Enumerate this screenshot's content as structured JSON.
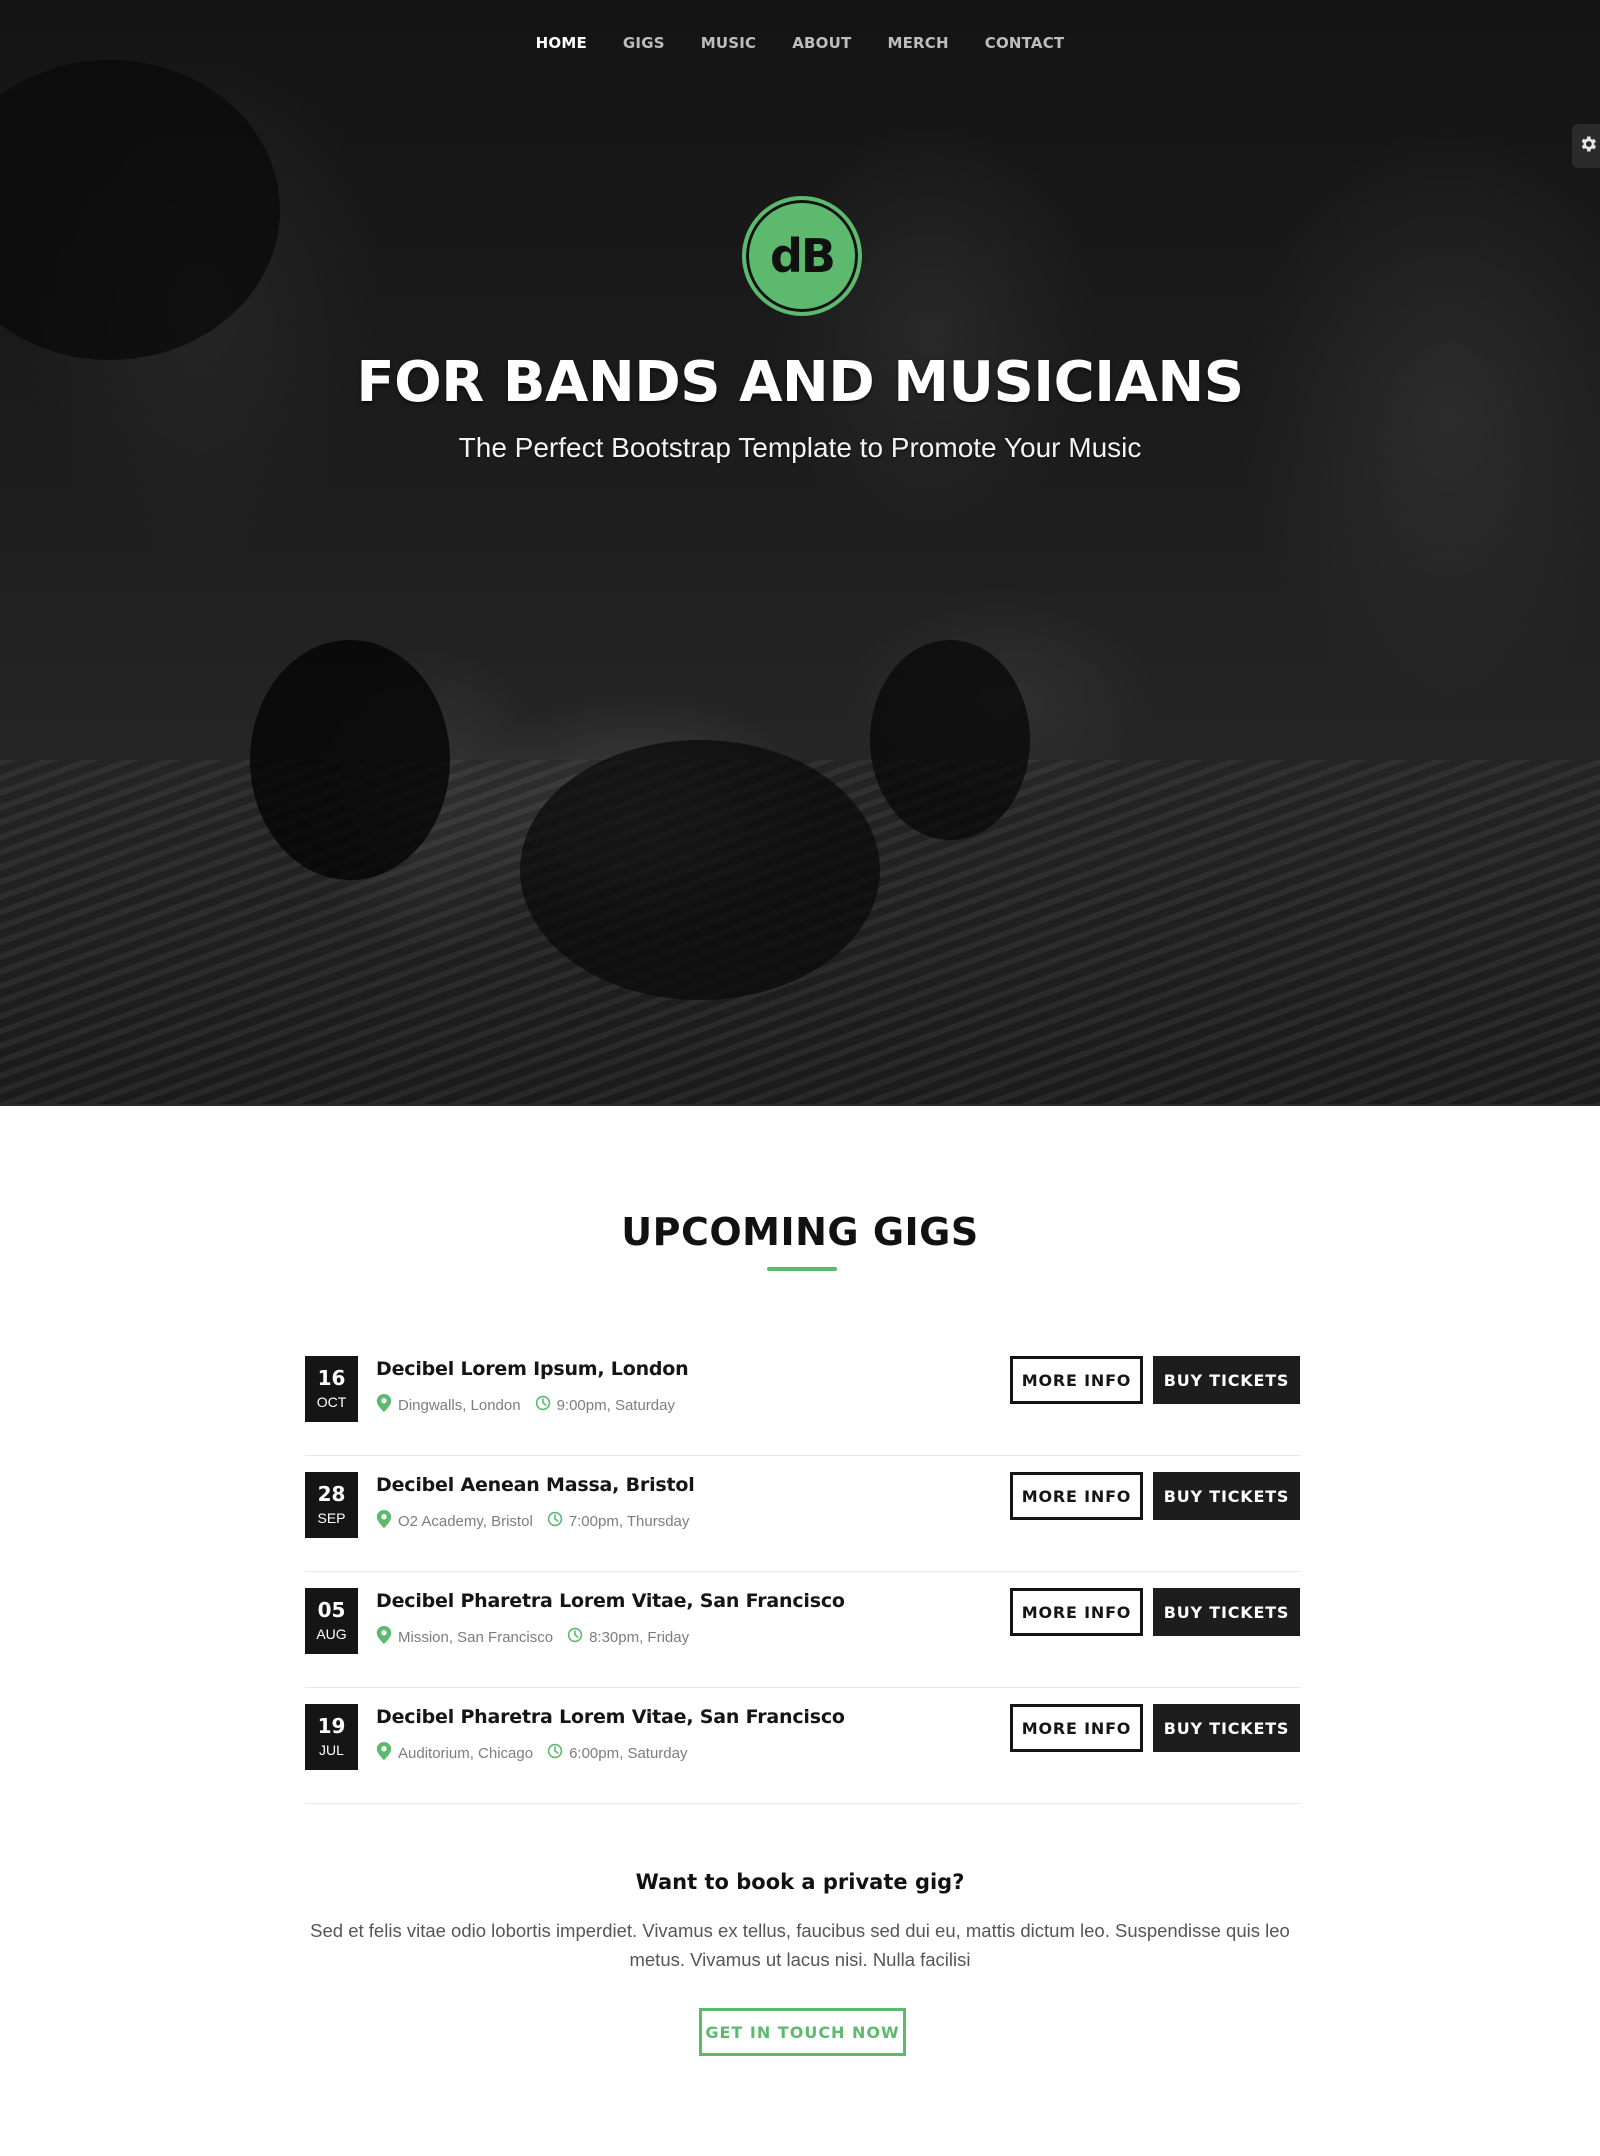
{
  "nav": {
    "items": [
      {
        "label": "HOME",
        "active": true
      },
      {
        "label": "GIGS",
        "active": false
      },
      {
        "label": "MUSIC",
        "active": false
      },
      {
        "label": "ABOUT",
        "active": false
      },
      {
        "label": "MERCH",
        "active": false
      },
      {
        "label": "CONTACT",
        "active": false
      }
    ]
  },
  "settings": {
    "icon": "gear-icon"
  },
  "hero": {
    "logo_text": "dB",
    "title": "FOR BANDS AND MUSICIANS",
    "subtitle": "The Perfect Bootstrap Template to Promote Your Music"
  },
  "gigs": {
    "title": "UPCOMING GIGS",
    "more_info_label": "MORE INFO",
    "buy_tickets_label": "BUY TICKETS",
    "items": [
      {
        "day": "16",
        "month": "OCT",
        "name": "Decibel Lorem Ipsum, London",
        "venue": "Dingwalls, London",
        "time": "9:00pm, Saturday"
      },
      {
        "day": "28",
        "month": "SEP",
        "name": "Decibel Aenean Massa, Bristol",
        "venue": "O2 Academy, Bristol",
        "time": "7:00pm, Thursday"
      },
      {
        "day": "05",
        "month": "AUG",
        "name": "Decibel Pharetra Lorem Vitae, San Francisco",
        "venue": "Mission, San Francisco",
        "time": "8:30pm, Friday"
      },
      {
        "day": "19",
        "month": "JUL",
        "name": "Decibel Pharetra Lorem Vitae, San Francisco",
        "venue": "Auditorium, Chicago",
        "time": "6:00pm, Saturday"
      }
    ]
  },
  "private_gig": {
    "title": "Want to book a private gig?",
    "text": "Sed et felis vitae odio lobortis imperdiet. Vivamus ex tellus, faucibus sed dui eu, mattis dictum leo. Suspendisse quis leo metus. Vivamus ut lacus nisi. Nulla facilisi",
    "button_label": "GET IN TOUCH NOW"
  },
  "colors": {
    "accent": "#5cb96d",
    "dark": "#151515",
    "muted_text": "#7d7d7d"
  }
}
